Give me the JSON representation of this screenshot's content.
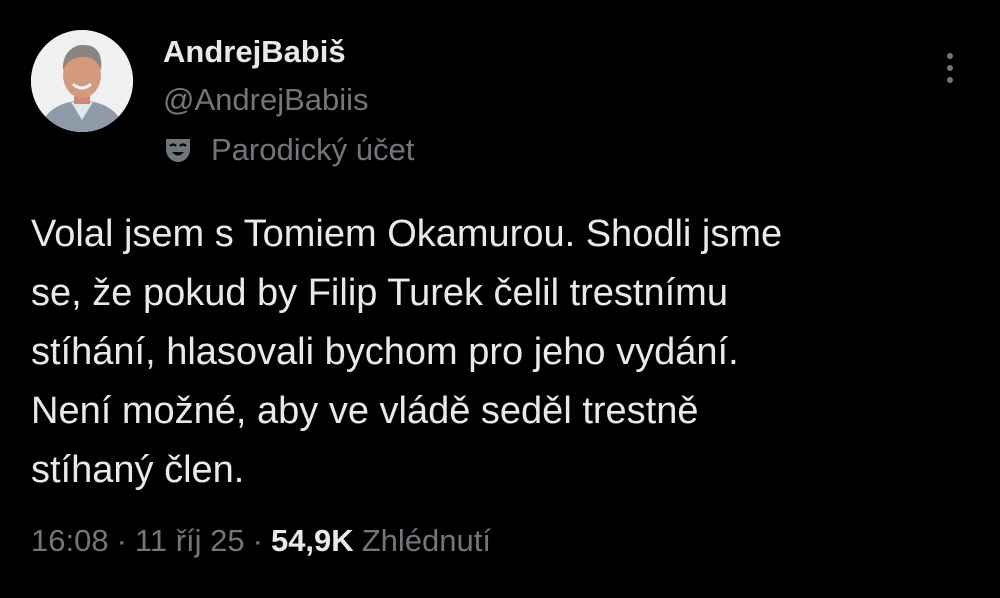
{
  "user": {
    "display_name": "AndrejBabiš",
    "handle": "@AndrejBabiis",
    "account_label": "Parodický účet",
    "label_icon": "theater-mask-icon",
    "avatar_icon": "avatar-photo"
  },
  "tweet": {
    "lines": [
      "Volal jsem s Tomiem Okamurou. Shodli jsme",
      "se, že pokud by Filip Turek čelil trestnímu",
      "stíhání, hlasovali bychom pro jeho vydání.",
      "Není možné, aby ve vládě seděl trestně",
      "stíhaný člen."
    ]
  },
  "meta": {
    "time": "16:08",
    "separator": "·",
    "date": "11 říj 25",
    "views_count": "54,9K",
    "views_label": "Zhlédnutí"
  },
  "more_icon": "more-vertical-icon",
  "colors": {
    "background": "#000000",
    "primary_text": "#e7e9ea",
    "secondary_text": "#71767b"
  }
}
